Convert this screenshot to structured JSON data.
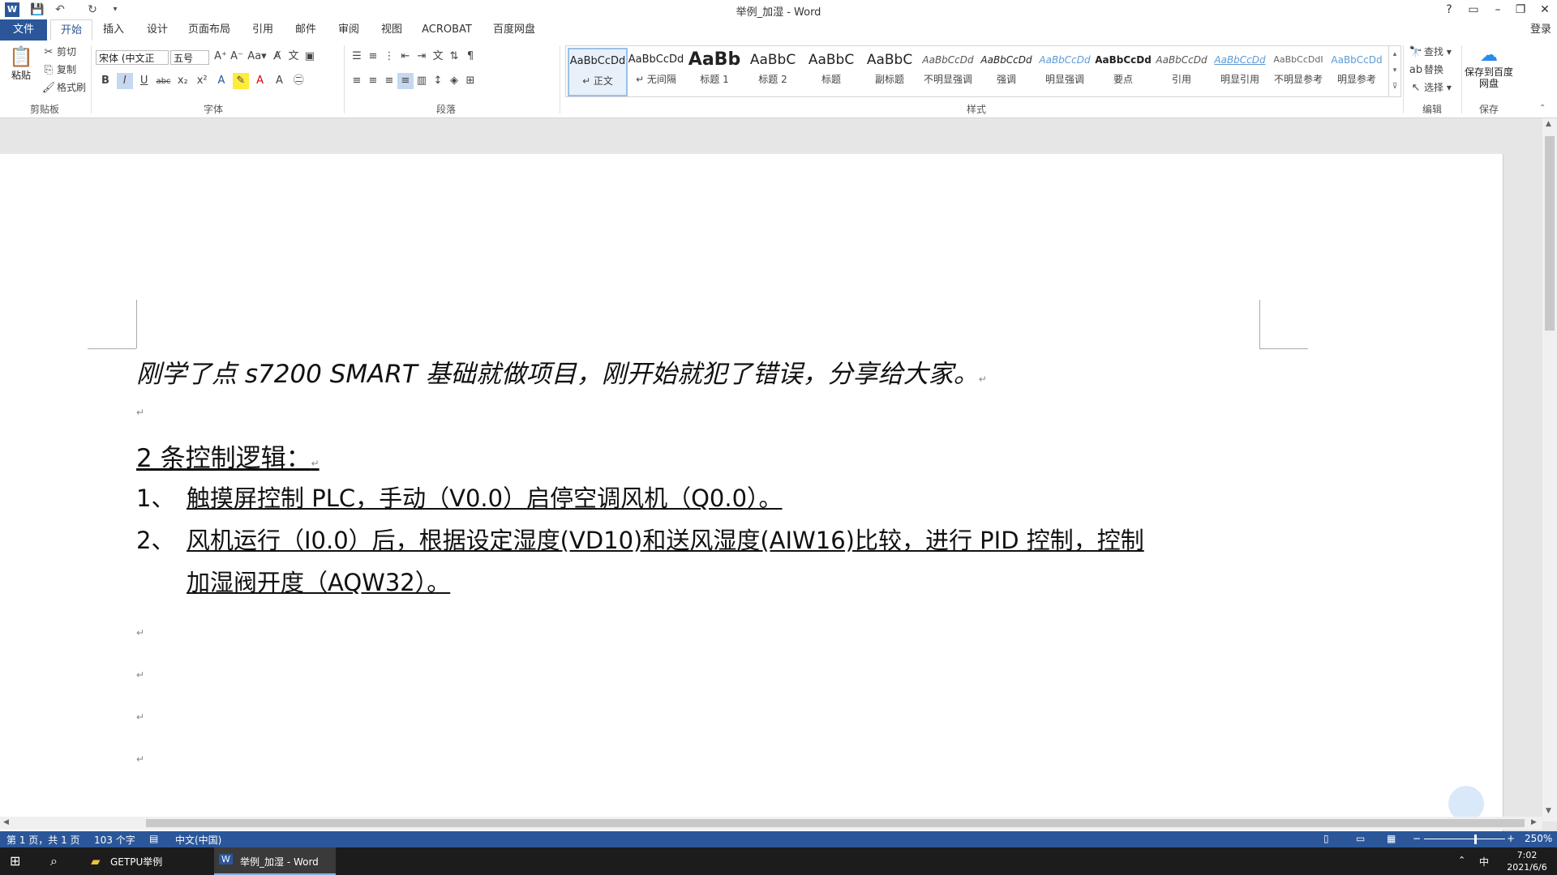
{
  "window": {
    "title": "举例_加湿 - Word",
    "help": "?",
    "login": "登录"
  },
  "tabs": [
    "文件",
    "开始",
    "插入",
    "设计",
    "页面布局",
    "引用",
    "邮件",
    "审阅",
    "视图",
    "ACROBAT",
    "百度网盘"
  ],
  "ribbon": {
    "clipboard": {
      "paste": "粘贴",
      "cut": "剪切",
      "copy": "复制",
      "format_painter": "格式刷",
      "label": "剪贴板"
    },
    "font": {
      "font_name": "宋体 (中文正",
      "font_size": "五号",
      "label": "字体",
      "bold": "B",
      "italic": "I",
      "underline": "U",
      "strike": "abc",
      "sub": "x₂",
      "sup": "x²"
    },
    "paragraph": {
      "label": "段落"
    },
    "styles": {
      "label": "样式",
      "items": [
        {
          "preview": "AaBbCcDd",
          "name": "↵ 正文"
        },
        {
          "preview": "AaBbCcDd",
          "name": "↵ 无间隔"
        },
        {
          "preview": "AaBb",
          "name": "标题 1"
        },
        {
          "preview": "AaBbC",
          "name": "标题 2"
        },
        {
          "preview": "AaBbC",
          "name": "标题"
        },
        {
          "preview": "AaBbC",
          "name": "副标题"
        },
        {
          "preview": "AaBbCcDd",
          "name": "不明显强调"
        },
        {
          "preview": "AaBbCcDd",
          "name": "强调"
        },
        {
          "preview": "AaBbCcDd",
          "name": "明显强调"
        },
        {
          "preview": "AaBbCcDd",
          "name": "要点"
        },
        {
          "preview": "AaBbCcDd",
          "name": "引用"
        },
        {
          "preview": "AaBbCcDd",
          "name": "明显引用"
        },
        {
          "preview": "AaBbCcDdI",
          "name": "不明显参考"
        },
        {
          "preview": "AaBbCcDd",
          "name": "明显参考"
        }
      ]
    },
    "editing": {
      "find": "查找",
      "replace": "替换",
      "select": "选择",
      "label": "编辑"
    },
    "save": {
      "save_to_baidu": "保存到百度网盘",
      "label": "保存"
    }
  },
  "document": {
    "line1": "刚学了点 s7200 SMART 基础就做项目，刚开始就犯了错误，分享给大家。",
    "heading": "2 条控制逻辑：",
    "item1_num": "1、",
    "item1_text": "触摸屏控制 PLC，手动（V0.0）启停空调风机（Q0.0）。",
    "item2_num": "2、",
    "item2_text_a": "风机运行（I0.0）后，根据设定湿度(VD10)和送风湿度(AIW16)比较，进行 PID 控制，控制",
    "item2_text_b": "加湿阀开度（AQW32）。",
    "para_mark": "↵"
  },
  "status": {
    "page": "第 1 页，共 1 页",
    "words": "103 个字",
    "language": "中文(中国)",
    "zoom": "250%"
  },
  "taskbar": {
    "app1": "GETPU举例",
    "app2": "举例_加湿 - Word",
    "ime": "中",
    "time": "7:02",
    "date": "2021/6/6"
  },
  "colors": {
    "accent": "#2b579a",
    "taskbar": "#1c1c1c"
  }
}
